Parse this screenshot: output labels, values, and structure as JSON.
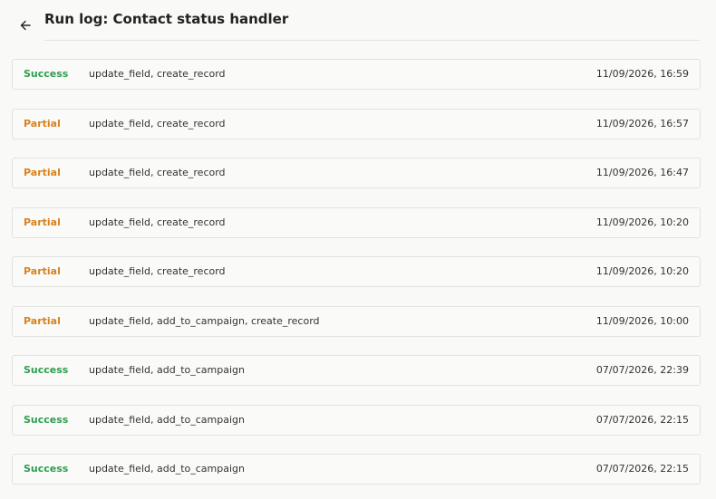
{
  "header": {
    "title": "Run log: Contact status handler",
    "back_icon": "arrow-left-icon"
  },
  "colors": {
    "success": "#2e9e4f",
    "partial": "#d9821f"
  },
  "runs": [
    {
      "status": "Success",
      "actions": "update_field, create_record",
      "timestamp": "11/09/2026, 16:59"
    },
    {
      "status": "Partial",
      "actions": "update_field, create_record",
      "timestamp": "11/09/2026, 16:57"
    },
    {
      "status": "Partial",
      "actions": "update_field, create_record",
      "timestamp": "11/09/2026, 16:47"
    },
    {
      "status": "Partial",
      "actions": "update_field, create_record",
      "timestamp": "11/09/2026, 10:20"
    },
    {
      "status": "Partial",
      "actions": "update_field, create_record",
      "timestamp": "11/09/2026, 10:20"
    },
    {
      "status": "Partial",
      "actions": "update_field, add_to_campaign, create_record",
      "timestamp": "11/09/2026, 10:00"
    },
    {
      "status": "Success",
      "actions": "update_field, add_to_campaign",
      "timestamp": "07/07/2026, 22:39"
    },
    {
      "status": "Success",
      "actions": "update_field, add_to_campaign",
      "timestamp": "07/07/2026, 22:15"
    },
    {
      "status": "Success",
      "actions": "update_field, add_to_campaign",
      "timestamp": "07/07/2026, 22:15"
    }
  ]
}
